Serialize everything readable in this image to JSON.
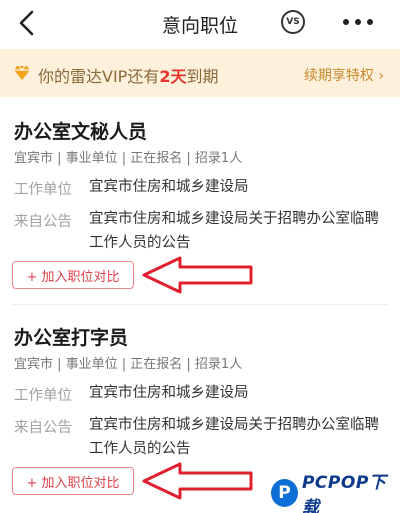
{
  "nav": {
    "title": "意向职位",
    "vs_label": "VS"
  },
  "vip_banner": {
    "prefix": "你的雷达VIP还有",
    "days": "2天",
    "suffix": "到期",
    "renew_link": "续期享特权",
    "renew_arrow": "›"
  },
  "jobs": [
    {
      "title": "办公室文秘人员",
      "meta": "宜宾市 | 事业单位 | 正在报名 | 招录1人",
      "employer_label": "工作单位",
      "employer": "宜宾市住房和城乡建设局",
      "notice_label": "来自公告",
      "notice": "宜宾市住房和城乡建设局关于招聘办公室临聘工作人员的公告",
      "add_button": "+ 加入职位对比"
    },
    {
      "title": "办公室打字员",
      "meta": "宜宾市 | 事业单位 | 正在报名 | 招录1人",
      "employer_label": "工作单位",
      "employer": "宜宾市住房和城乡建设局",
      "notice_label": "来自公告",
      "notice": "宜宾市住房和城乡建设局关于招聘办公室临聘工作人员的公告",
      "add_button": "+ 加入职位对比"
    }
  ],
  "watermark": {
    "logo_letter": "P",
    "text": "PCPOP下载"
  },
  "colors": {
    "vip_bg": "#fdf1dc",
    "vip_text": "#8a6a3a",
    "highlight": "#e8332b",
    "annotation_arrow": "#e0202e",
    "button_border": "#e8868a"
  }
}
